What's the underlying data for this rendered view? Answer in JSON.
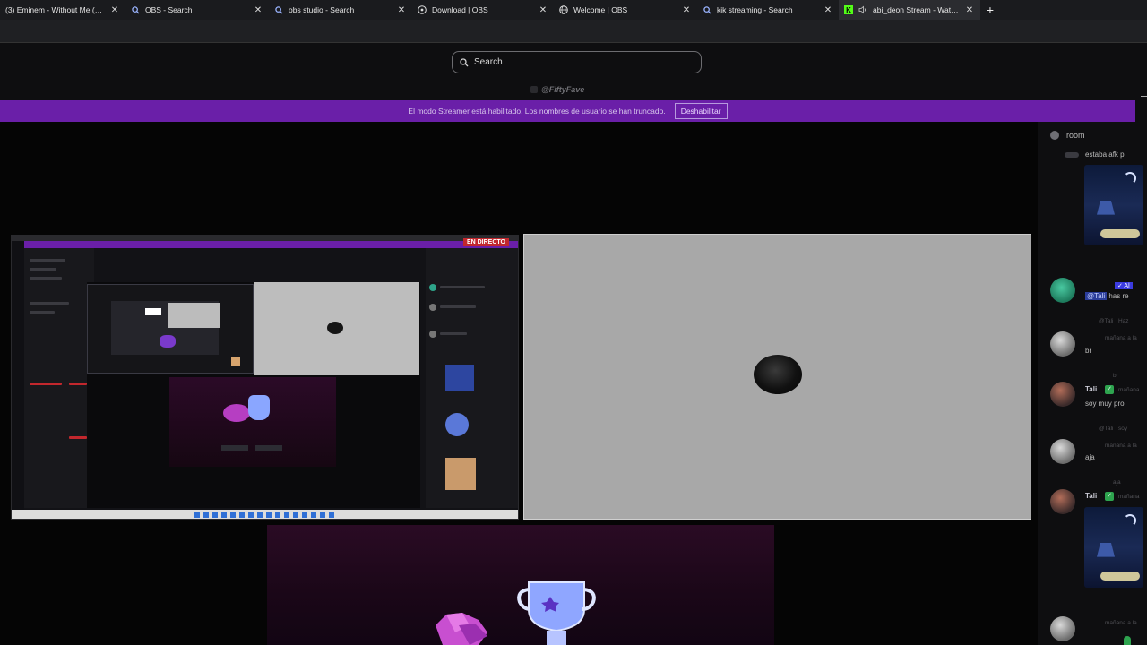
{
  "browser": {
    "tabs": [
      {
        "title": "(3) Eminem - Without Me (Remix)",
        "favicon": "audio-icon",
        "active": false
      },
      {
        "title": "OBS - Search",
        "favicon": "search-icon",
        "active": false
      },
      {
        "title": "obs studio - Search",
        "favicon": "search-icon",
        "active": false
      },
      {
        "title": "Download | OBS",
        "favicon": "obs-icon",
        "active": false
      },
      {
        "title": "Welcome | OBS",
        "favicon": "globe-icon",
        "active": false
      },
      {
        "title": "kik streaming - Search",
        "favicon": "search-icon",
        "active": false
      },
      {
        "title": "abi_deon Stream - Watch Live",
        "favicon": "kick-icon",
        "active": true
      }
    ],
    "new_tab_label": "+"
  },
  "header": {
    "search_placeholder": "Search"
  },
  "channel": {
    "handle": "@FiftyFave"
  },
  "banner": {
    "message": "El modo Streamer está habilitado. Los nombres de usuario se han truncado.",
    "button_label": "Deshabilitar",
    "color": "#6a1fa8"
  },
  "stream": {
    "live_badge": "EN DIRECTO",
    "live_color": "#c2272d"
  },
  "chat": {
    "room_label": "room",
    "messages": [
      {
        "text": "estaba afk p"
      },
      {
        "name": "@Tali",
        "text": "has re",
        "tag": "✓ Al"
      },
      {
        "name": "@Tali",
        "text": "Haz",
        "meta": "mañana a la"
      },
      {
        "text": "br"
      },
      {
        "name": "Tali",
        "text": "soy muy pro",
        "meta": "mañana",
        "reply": "br"
      },
      {
        "name": "@Tali",
        "text": "soy",
        "meta": "mañana a la"
      },
      {
        "text": "aja"
      },
      {
        "name": "Tali",
        "reply": "aja",
        "meta": "mañana"
      },
      {
        "meta": "mañana a la"
      }
    ]
  }
}
